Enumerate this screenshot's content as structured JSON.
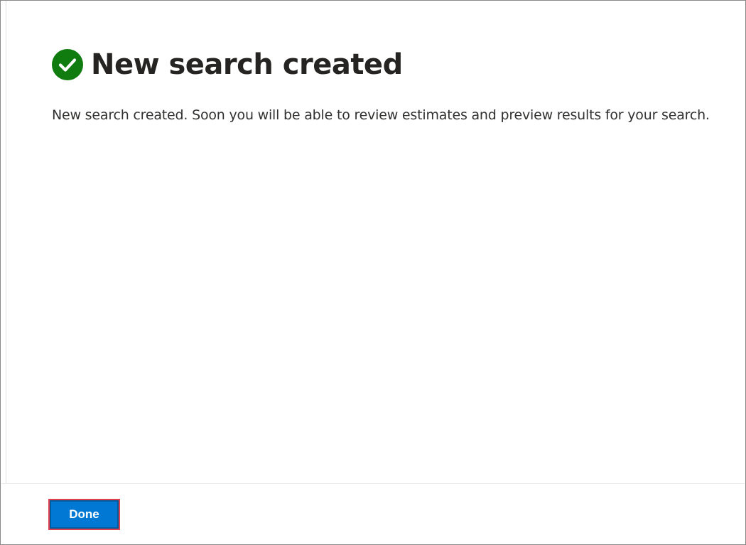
{
  "dialog": {
    "title": "New search created",
    "message": "New search created. Soon you will be able to review estimates and preview results for your search.",
    "status_icon": "success-check-icon",
    "colors": {
      "success": "#107c10",
      "primary_button": "#0078d4",
      "highlight_outline": "#e0404e"
    }
  },
  "footer": {
    "done_label": "Done"
  }
}
